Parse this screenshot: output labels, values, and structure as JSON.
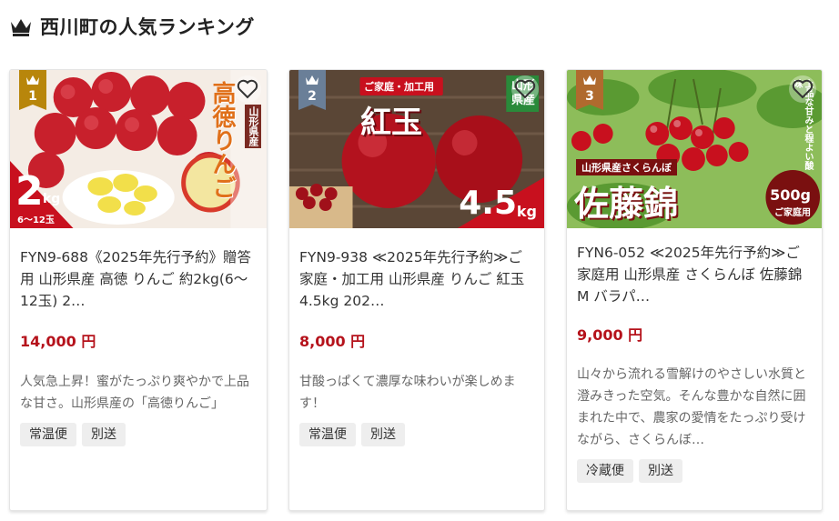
{
  "header": {
    "title": "西川町の人気ランキング",
    "icon": "crown-icon"
  },
  "colors": {
    "price": "#b5121b",
    "rank1": "#b8860b",
    "rank2": "#6a7f98",
    "rank3": "#b06a2e"
  },
  "cards": [
    {
      "rank": "1",
      "image_text": {
        "main": "高徳りんご",
        "side": "山形県産",
        "weight": "2",
        "unit": "kg",
        "range": "6〜12玉"
      },
      "title": "FYN9-688《2025年先行予約》贈答用 山形県産 高徳 りんご 約2kg(6〜12玉) 2…",
      "price": "14,000 円",
      "description": "人気急上昇！蜜がたっぷり爽やかで上品な甘さ。山形県産の「高徳りんご」",
      "tags": [
        "常温便",
        "別送"
      ]
    },
    {
      "rank": "2",
      "image_text": {
        "main": "紅玉",
        "banner": "ご家庭・加工用",
        "side": "山形県産",
        "weight": "4.5",
        "unit": "kg"
      },
      "title": "FYN9-938 ≪2025年先行予約≫ご家庭・加工用 山形県産 りんご 紅玉 4.5kg 202…",
      "price": "8,000 円",
      "description": "甘酸っぱくて濃厚な味わいが楽しめます！",
      "tags": [
        "常温便",
        "別送"
      ]
    },
    {
      "rank": "3",
      "image_text": {
        "main": "佐藤錦",
        "sub": "山形県産さくらんぼ",
        "note": "上品な甘みと程よい酸味",
        "weight": "500g",
        "use": "ご家庭用"
      },
      "title": "FYN6-052 ≪2025年先行予約≫ご家庭用 山形県産 さくらんぼ 佐藤錦 M バラパ…",
      "price": "9,000 円",
      "description": "山々から流れる雪解けのやさしい水質と澄みきった空気。そんな豊かな自然に囲まれた中で、農家の愛情をたっぷり受けながら、さくらんぼ…",
      "tags": [
        "冷蔵便",
        "別送"
      ]
    }
  ]
}
